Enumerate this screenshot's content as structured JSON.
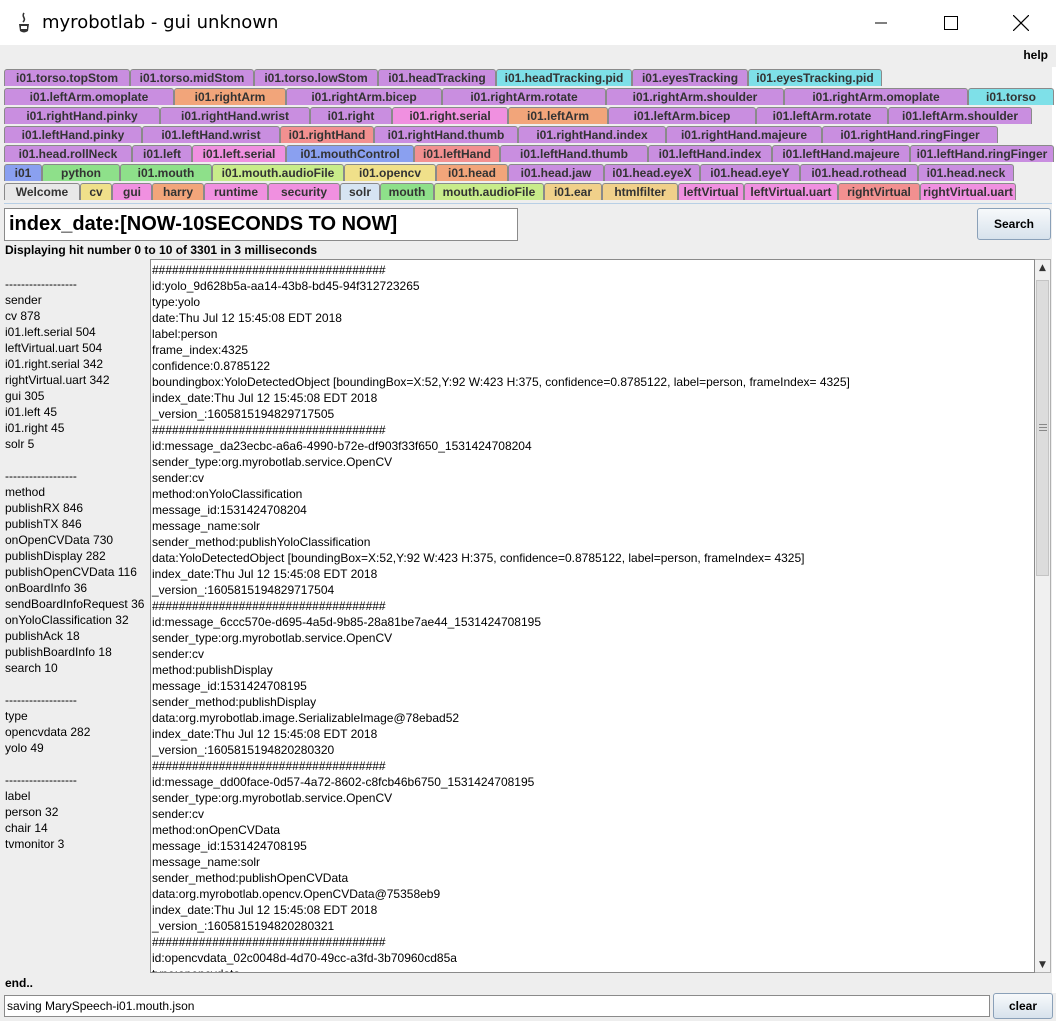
{
  "window": {
    "title": "myrobotlab - gui unknown",
    "controls": {
      "minimize": "—",
      "maximize": "☐",
      "close": "✕"
    }
  },
  "menu": {
    "help": "help"
  },
  "tab_rows": [
    [
      {
        "label": "i01.torso.topStom",
        "color": "#c98ee0"
      },
      {
        "label": "i01.torso.midStom",
        "color": "#c98ee0"
      },
      {
        "label": "i01.torso.lowStom",
        "color": "#c98ee0"
      },
      {
        "label": "i01.headTracking",
        "color": "#c98ee0"
      },
      {
        "label": "i01.headTracking.pid",
        "color": "#7ee0e8"
      },
      {
        "label": "i01.eyesTracking",
        "color": "#c98ee0"
      },
      {
        "label": "i01.eyesTracking.pid",
        "color": "#7ee0e8"
      }
    ],
    [
      {
        "label": "i01.leftArm.omoplate",
        "color": "#c98ee0"
      },
      {
        "label": "i01.rightArm",
        "color": "#f2a57a"
      },
      {
        "label": "i01.rightArm.bicep",
        "color": "#c98ee0"
      },
      {
        "label": "i01.rightArm.rotate",
        "color": "#c98ee0"
      },
      {
        "label": "i01.rightArm.shoulder",
        "color": "#c98ee0"
      },
      {
        "label": "i01.rightArm.omoplate",
        "color": "#c98ee0"
      },
      {
        "label": "i01.torso",
        "color": "#7ee0e8"
      }
    ],
    [
      {
        "label": "i01.rightHand.pinky",
        "color": "#c98ee0"
      },
      {
        "label": "i01.rightHand.wrist",
        "color": "#c98ee0"
      },
      {
        "label": "i01.right",
        "color": "#c98ee0"
      },
      {
        "label": "i01.right.serial",
        "color": "#f090e0"
      },
      {
        "label": "i01.leftArm",
        "color": "#f2a57a"
      },
      {
        "label": "i01.leftArm.bicep",
        "color": "#c98ee0"
      },
      {
        "label": "i01.leftArm.rotate",
        "color": "#c98ee0"
      },
      {
        "label": "i01.leftArm.shoulder",
        "color": "#c98ee0"
      }
    ],
    [
      {
        "label": "i01.leftHand.pinky",
        "color": "#c98ee0"
      },
      {
        "label": "i01.leftHand.wrist",
        "color": "#c98ee0"
      },
      {
        "label": "i01.rightHand",
        "color": "#f29090"
      },
      {
        "label": "i01.rightHand.thumb",
        "color": "#c98ee0"
      },
      {
        "label": "i01.rightHand.index",
        "color": "#c98ee0"
      },
      {
        "label": "i01.rightHand.majeure",
        "color": "#c98ee0"
      },
      {
        "label": "i01.rightHand.ringFinger",
        "color": "#c98ee0"
      }
    ],
    [
      {
        "label": "i01.head.rollNeck",
        "color": "#c98ee0"
      },
      {
        "label": "i01.left",
        "color": "#c98ee0"
      },
      {
        "label": "i01.left.serial",
        "color": "#f090e0"
      },
      {
        "label": "i01.mouthControl",
        "color": "#8aa0f0"
      },
      {
        "label": "i01.leftHand",
        "color": "#f29090"
      },
      {
        "label": "i01.leftHand.thumb",
        "color": "#c98ee0"
      },
      {
        "label": "i01.leftHand.index",
        "color": "#c98ee0"
      },
      {
        "label": "i01.leftHand.majeure",
        "color": "#c98ee0"
      },
      {
        "label": "i01.leftHand.ringFinger",
        "color": "#c98ee0"
      }
    ],
    [
      {
        "label": "i01",
        "color": "#8aa0f0"
      },
      {
        "label": "python",
        "color": "#8ee08a"
      },
      {
        "label": "i01.mouth",
        "color": "#8ee08a"
      },
      {
        "label": "i01.mouth.audioFile",
        "color": "#c8ec8a"
      },
      {
        "label": "i01.opencv",
        "color": "#f0e08a"
      },
      {
        "label": "i01.head",
        "color": "#f2a57a"
      },
      {
        "label": "i01.head.jaw",
        "color": "#c98ee0"
      },
      {
        "label": "i01.head.eyeX",
        "color": "#c98ee0"
      },
      {
        "label": "i01.head.eyeY",
        "color": "#c98ee0"
      },
      {
        "label": "i01.head.rothead",
        "color": "#c98ee0"
      },
      {
        "label": "i01.head.neck",
        "color": "#c98ee0"
      }
    ],
    [
      {
        "label": "Welcome",
        "color": "#e8e8e8"
      },
      {
        "label": "cv",
        "color": "#f0e08a"
      },
      {
        "label": "gui",
        "color": "#f090e0"
      },
      {
        "label": "harry",
        "color": "#f2a57a"
      },
      {
        "label": "runtime",
        "color": "#f090e0"
      },
      {
        "label": "security",
        "color": "#f090e0"
      },
      {
        "label": "solr",
        "color": "#d6e4f2"
      },
      {
        "label": "mouth",
        "color": "#8ee08a"
      },
      {
        "label": "mouth.audioFile",
        "color": "#c8ec8a"
      },
      {
        "label": "i01.ear",
        "color": "#f0d08a"
      },
      {
        "label": "htmlfilter",
        "color": "#f0d08a"
      },
      {
        "label": "leftVirtual",
        "color": "#f090e0"
      },
      {
        "label": "leftVirtual.uart",
        "color": "#f090e0"
      },
      {
        "label": "rightVirtual",
        "color": "#f29090"
      },
      {
        "label": "rightVirtual.uart",
        "color": "#f090e0"
      }
    ]
  ],
  "solr": {
    "query": "index_date:[NOW-10SECONDS TO NOW]",
    "search_label": "Search",
    "hits": "Displaying hit number 0 to 10 of 3301 in 3 milliseconds",
    "facets": [
      "",
      "------------------",
      "sender",
      "cv 878",
      "i01.left.serial 504",
      "leftVirtual.uart 504",
      "i01.right.serial 342",
      "rightVirtual.uart 342",
      "gui 305",
      "i01.left 45",
      "i01.right 45",
      "solr 5",
      "",
      "------------------",
      "method",
      "publishRX 846",
      "publishTX 846",
      "onOpenCVData 730",
      "publishDisplay 282",
      "publishOpenCVData 116",
      "onBoardInfo 36",
      "sendBoardInfoRequest 36",
      "onYoloClassification 32",
      "publishAck 18",
      "publishBoardInfo 18",
      "search 10",
      "",
      "------------------",
      "type",
      "opencvdata 282",
      "yolo 49",
      "",
      "------------------",
      "label",
      "person 32",
      "chair 14",
      "tvmonitor 3"
    ],
    "results": [
      "###################################",
      "id:yolo_9d628b5a-aa14-43b8-bd45-94f312723265",
      "type:yolo",
      "date:Thu Jul 12 15:45:08 EDT 2018",
      "label:person",
      "frame_index:4325",
      "confidence:0.8785122",
      "boundingbox:YoloDetectedObject [boundingBox=X:52,Y:92 W:423 H:375, confidence=0.8785122, label=person, frameIndex= 4325]",
      "index_date:Thu Jul 12 15:45:08 EDT 2018",
      "_version_:1605815194829717505",
      "###################################",
      "id:message_da23ecbc-a6a6-4990-b72e-df903f33f650_1531424708204",
      "sender_type:org.myrobotlab.service.OpenCV",
      "sender:cv",
      "method:onYoloClassification",
      "message_id:1531424708204",
      "message_name:solr",
      "sender_method:publishYoloClassification",
      "data:YoloDetectedObject [boundingBox=X:52,Y:92 W:423 H:375, confidence=0.8785122, label=person, frameIndex= 4325]",
      "index_date:Thu Jul 12 15:45:08 EDT 2018",
      "_version_:1605815194829717504",
      "###################################",
      "id:message_6ccc570e-d695-4a5d-9b85-28a81be7ae44_1531424708195",
      "sender_type:org.myrobotlab.service.OpenCV",
      "sender:cv",
      "method:publishDisplay",
      "message_id:1531424708195",
      "sender_method:publishDisplay",
      "data:org.myrobotlab.image.SerializableImage@78ebad52",
      "index_date:Thu Jul 12 15:45:08 EDT 2018",
      "_version_:1605815194820280320",
      "###################################",
      "id:message_dd00face-0d57-4a72-8602-c8fcb46b6750_1531424708195",
      "sender_type:org.myrobotlab.service.OpenCV",
      "sender:cv",
      "method:onOpenCVData",
      "message_id:1531424708195",
      "message_name:solr",
      "sender_method:publishOpenCVData",
      "data:org.myrobotlab.opencv.OpenCVData@75358eb9",
      "index_date:Thu Jul 12 15:45:08 EDT 2018",
      "_version_:1605815194820280321",
      "###################################",
      "id:opencvdata_02c0048d-4d70-49cc-a3fd-3b70960cd85a",
      "type:opencvdata"
    ],
    "end": "end.."
  },
  "status": {
    "message": "saving MarySpeech-i01.mouth.json",
    "clear_label": "clear"
  }
}
